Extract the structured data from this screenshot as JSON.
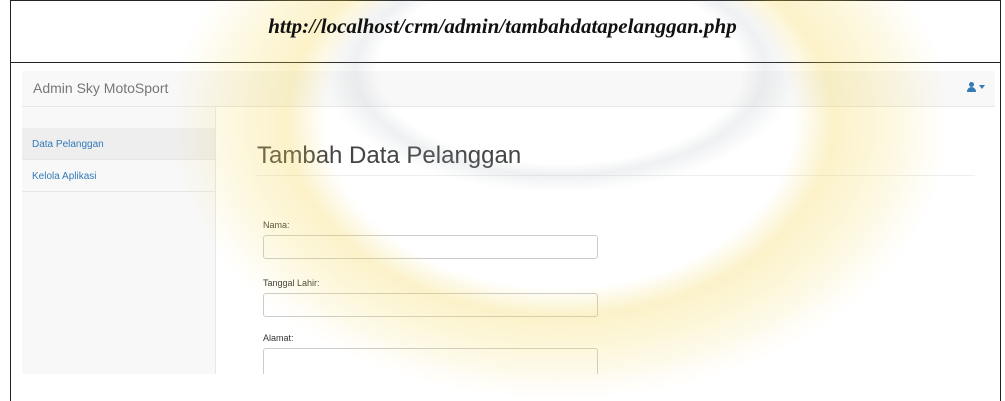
{
  "caption": {
    "url": "http://localhost/crm/admin/tambahdatapelanggan.php"
  },
  "navbar": {
    "brand": "Admin Sky MotoSport",
    "user_icon": "user-icon"
  },
  "sidebar": {
    "items": [
      {
        "label": "Data Pelanggan",
        "active": true
      },
      {
        "label": "Kelola Aplikasi",
        "active": false
      }
    ]
  },
  "main": {
    "title": "Tambah Data Pelanggan",
    "fields": [
      {
        "label": "Nama:",
        "value": ""
      },
      {
        "label": "Tanggal Lahir:",
        "value": ""
      },
      {
        "label": "Alamat:",
        "value": ""
      }
    ]
  },
  "colors": {
    "link": "#337ab7",
    "watermark": "#f2d34a",
    "navbar": "#f8f8f8"
  }
}
